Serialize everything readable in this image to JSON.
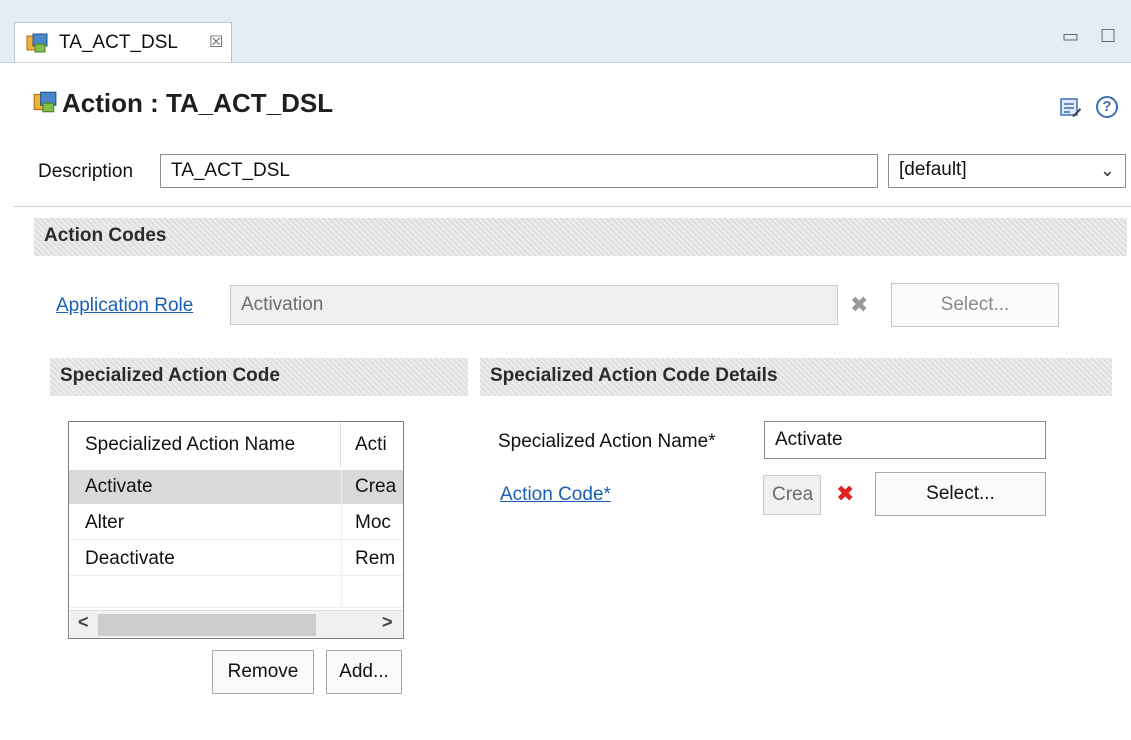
{
  "tab": {
    "label": "TA_ACT_DSL",
    "close_glyph": "☒"
  },
  "window_controls": {
    "minimize_glyph": "▭",
    "maximize_glyph": "☐"
  },
  "header": {
    "title": "Action : TA_ACT_DSL",
    "icons": [
      "action-editor-icon",
      "info-icon",
      "help-icon"
    ],
    "help_glyph": "?"
  },
  "description": {
    "label": "Description",
    "value": "TA_ACT_DSL",
    "language": "[default]",
    "dropdown_glyph": "⌄"
  },
  "action_codes": {
    "title": "Action Codes",
    "application_role": {
      "label": "Application Role",
      "value": "Activation",
      "clear_glyph": "✖",
      "select_label": "Select..."
    }
  },
  "specialized_action_code": {
    "title": "Specialized Action Code",
    "columns": [
      "Specialized Action Name",
      "Acti"
    ],
    "rows": [
      {
        "name": "Activate",
        "code": "Crea",
        "selected": true
      },
      {
        "name": "Alter",
        "code": "Moc",
        "selected": false
      },
      {
        "name": "Deactivate",
        "code": "Rem",
        "selected": false
      }
    ],
    "scroll_left_glyph": "<",
    "scroll_right_glyph": ">",
    "remove_label": "Remove",
    "add_label": "Add..."
  },
  "details": {
    "title": "Specialized Action Code Details",
    "name_label": "Specialized Action Name*",
    "name_value": "Activate",
    "action_code_label": "Action Code*",
    "action_code_value": "Crea",
    "clear_glyph": "✖",
    "select_label": "Select..."
  },
  "colors": {
    "link": "#1a5fb4",
    "section_bg": "#e3e3e3",
    "clear_active": "#e02020",
    "clear_disabled": "#9a9a9a",
    "tabstrip_bg": "#e4ecf5"
  }
}
